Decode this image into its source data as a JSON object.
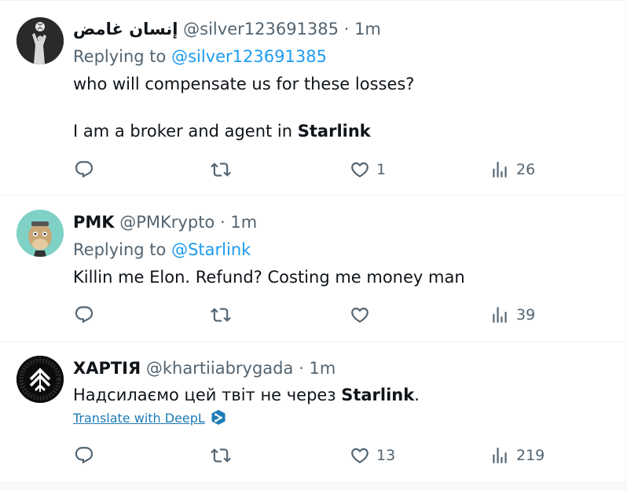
{
  "tweets": [
    {
      "display_name": "إنسان غامض",
      "handle": "@silver123691385",
      "sep": "·",
      "time": "1m",
      "replying_prefix": "Replying to",
      "replying_to": "@silver123691385",
      "line1": "who will compensate us for these losses?",
      "line2_prefix": "I am a broker and agent in ",
      "line2_bold": "Starlink",
      "likes": "1",
      "views": "26",
      "avatar_icon": "soccer-player-avatar"
    },
    {
      "display_name": "PMK",
      "handle": "@PMKrypto",
      "sep": "·",
      "time": "1m",
      "replying_prefix": "Replying to",
      "replying_to": "@Starlink",
      "line1": "Killin me Elon. Refund? Costing me money man",
      "likes": "",
      "views": "39",
      "avatar_icon": "ape-nft-avatar"
    },
    {
      "display_name": "ХАРТІЯ",
      "handle": "@khartiiabrygada",
      "sep": "·",
      "time": "1m",
      "text_prefix": "Надсилаємо цей твіт не через ",
      "text_bold": "Starlink",
      "text_suffix": ".",
      "translate": "Translate with DeepL",
      "likes": "13",
      "views": "219",
      "avatar_icon": "khartiia-emblem-avatar"
    }
  ],
  "colors": {
    "link": "#1d9bf0",
    "muted": "#536471",
    "text": "#0f1419",
    "divider": "#eff3f4",
    "deepl": "#1d7bb6"
  }
}
